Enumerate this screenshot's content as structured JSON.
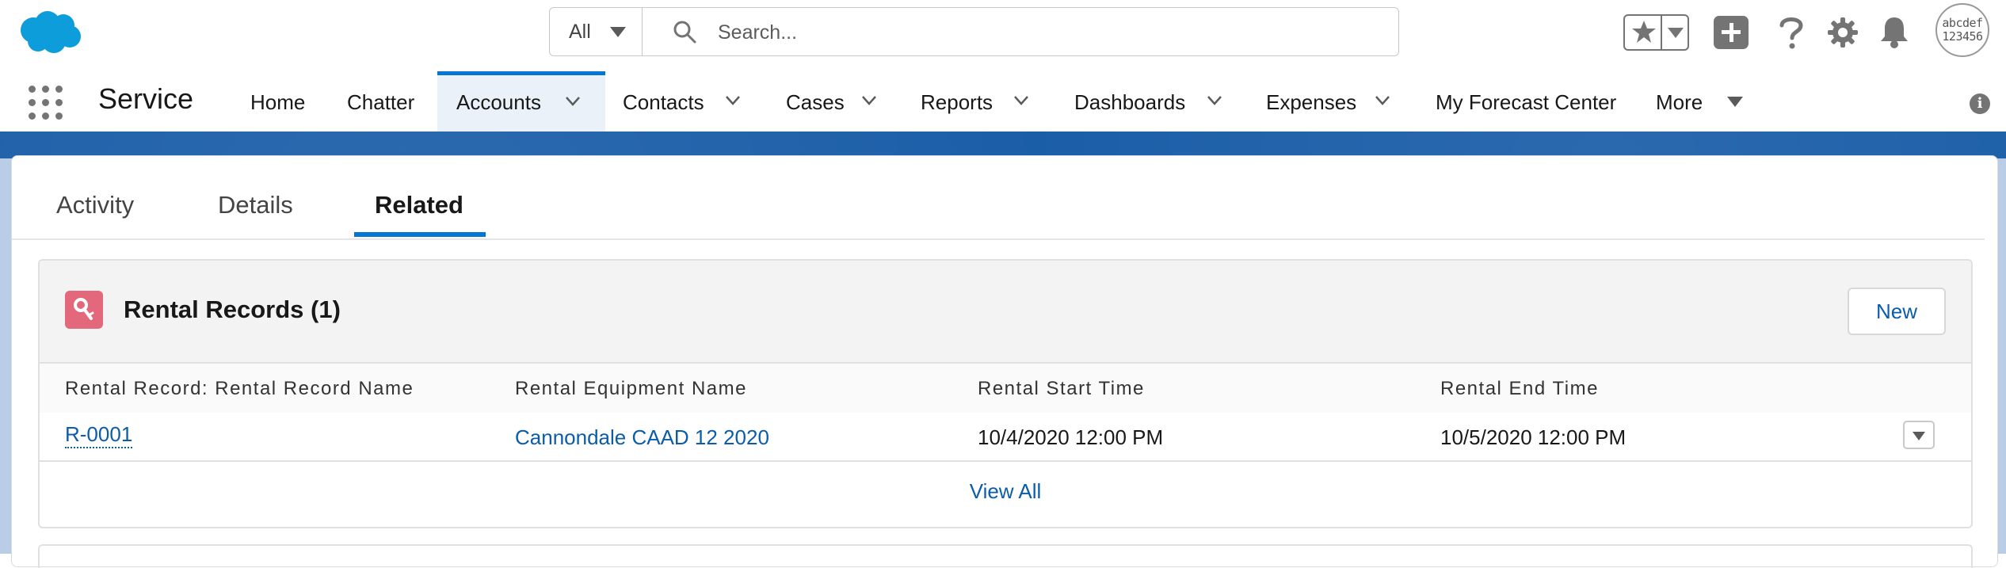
{
  "header": {
    "search_scope": "All",
    "search_placeholder": "Search...",
    "avatar_text": [
      "abcdef",
      "123456"
    ]
  },
  "nav": {
    "app_name": "Service",
    "items": [
      {
        "label": "Home",
        "has_menu": false
      },
      {
        "label": "Chatter",
        "has_menu": false
      },
      {
        "label": "Accounts",
        "has_menu": true,
        "active": true
      },
      {
        "label": "Contacts",
        "has_menu": true
      },
      {
        "label": "Cases",
        "has_menu": true
      },
      {
        "label": "Reports",
        "has_menu": true
      },
      {
        "label": "Dashboards",
        "has_menu": true
      },
      {
        "label": "Expenses",
        "has_menu": true
      },
      {
        "label": "My Forecast Center",
        "has_menu": false
      },
      {
        "label": "More",
        "has_menu": true
      }
    ],
    "info_icon": "i"
  },
  "tabs": [
    {
      "label": "Activity"
    },
    {
      "label": "Details"
    },
    {
      "label": "Related",
      "active": true
    }
  ],
  "related_list": {
    "title": "Rental Records (1)",
    "new_label": "New",
    "icon": "key-icon",
    "icon_color": "#e3687b",
    "columns": [
      "Rental Record: Rental Record Name",
      "Rental Equipment Name",
      "Rental Start Time",
      "Rental End Time"
    ],
    "rows": [
      [
        "R-0001",
        "Cannondale CAAD 12 2020",
        "10/4/2020 12:00 PM",
        "10/5/2020 12:00 PM"
      ]
    ],
    "view_all_label": "View All"
  },
  "colors": {
    "brand_blue": "#0176d3",
    "link_blue": "#0b5cab",
    "band_blue": "#1b5ea8"
  }
}
